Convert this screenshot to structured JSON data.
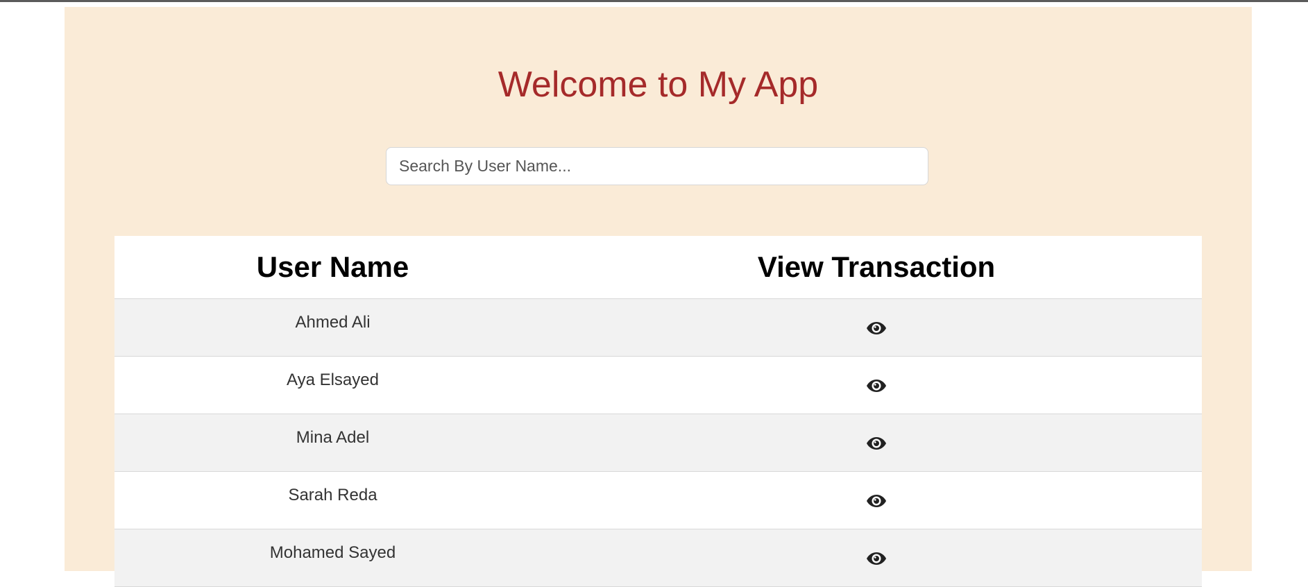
{
  "header": {
    "title": "Welcome to My App"
  },
  "search": {
    "placeholder": "Search By User Name...",
    "value": ""
  },
  "table": {
    "columns": [
      "User Name",
      "View Transaction"
    ],
    "rows": [
      {
        "user_name": "Ahmed Ali",
        "action_icon": "eye-icon"
      },
      {
        "user_name": "Aya Elsayed",
        "action_icon": "eye-icon"
      },
      {
        "user_name": "Mina Adel",
        "action_icon": "eye-icon"
      },
      {
        "user_name": "Sarah Reda",
        "action_icon": "eye-icon"
      },
      {
        "user_name": "Mohamed Sayed",
        "action_icon": "eye-icon"
      }
    ]
  },
  "colors": {
    "panel_background": "#faebd7",
    "title": "#a52a2a",
    "row_stripe": "#f2f2f2"
  }
}
